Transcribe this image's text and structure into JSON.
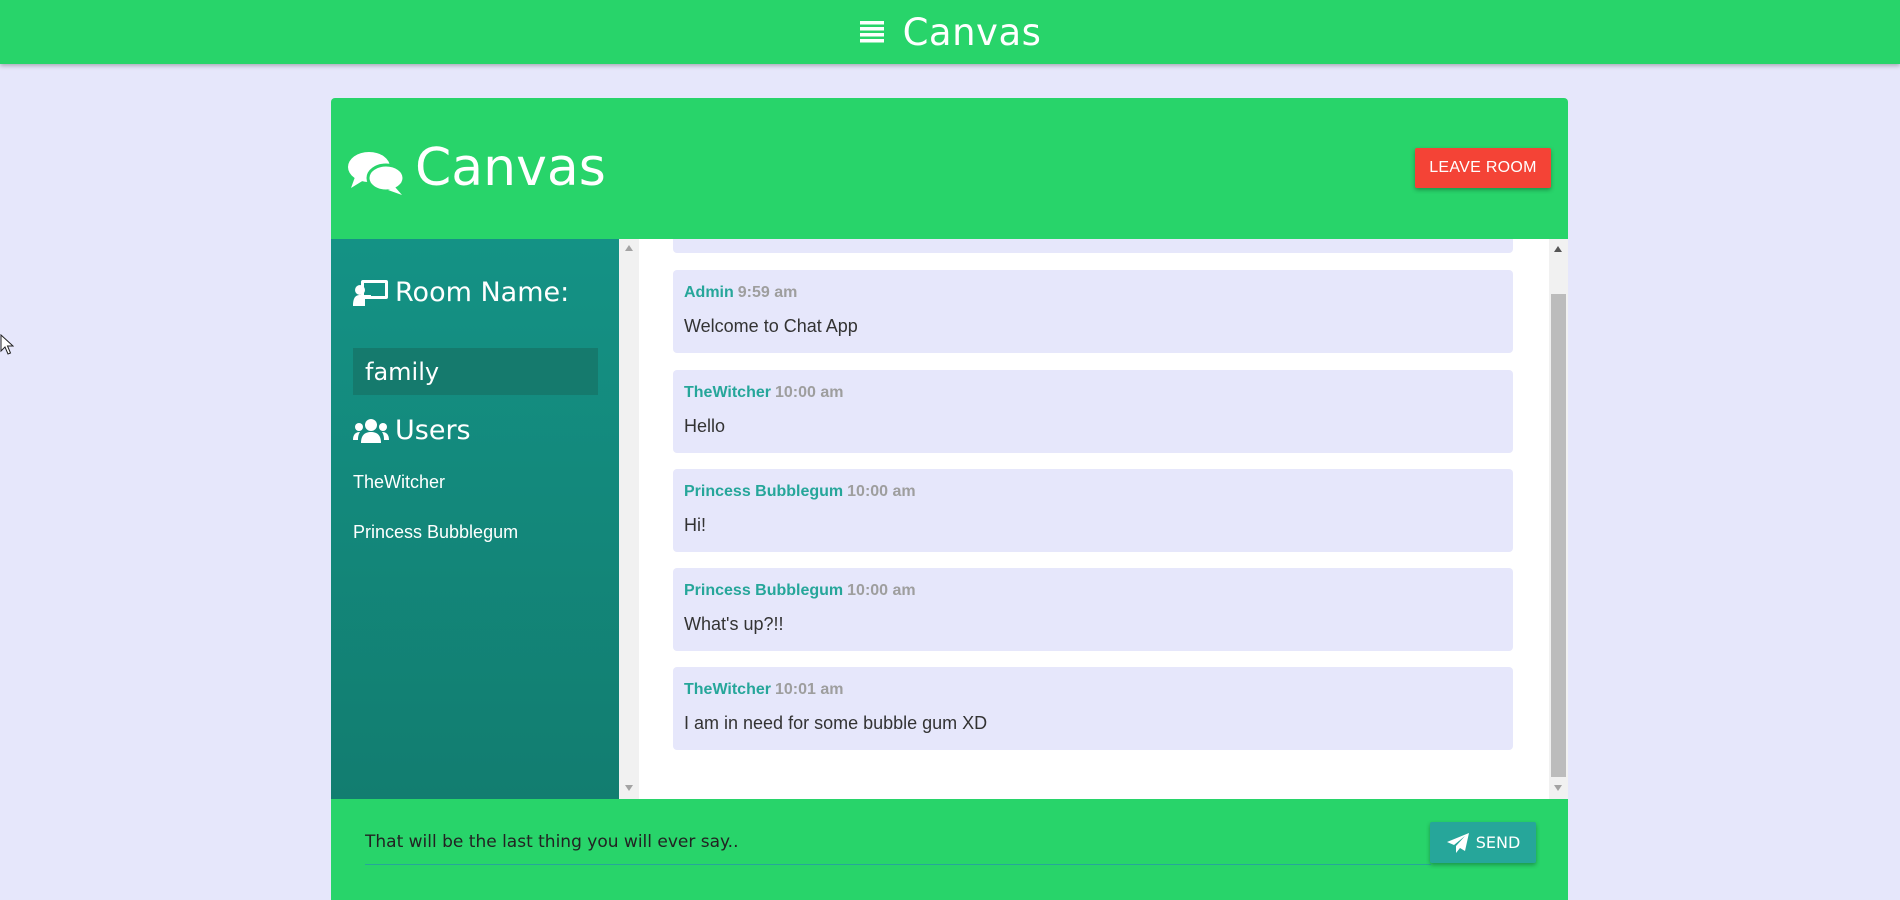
{
  "topbar": {
    "brand": "Canvas",
    "menu_icon": "menu-lines-icon"
  },
  "header": {
    "title": "Canvas",
    "chat_icon": "chat-bubbles-icon",
    "leave_label": "LEAVE ROOM"
  },
  "sidebar": {
    "room_heading": "Room Name:",
    "room_name": "family",
    "users_heading": "Users",
    "users": [
      "TheWitcher",
      "Princess Bubblegum"
    ]
  },
  "messages": [
    {
      "author": "Admin",
      "time": "9:59 am",
      "text": "Welcome to Chat App"
    },
    {
      "author": "TheWitcher",
      "time": "10:00 am",
      "text": "Hello"
    },
    {
      "author": "Princess Bubblegum",
      "time": "10:00 am",
      "text": "Hi!"
    },
    {
      "author": "Princess Bubblegum",
      "time": "10:00 am",
      "text": "What's up?!!"
    },
    {
      "author": "TheWitcher",
      "time": "10:01 am",
      "text": "I am in need for some bubble gum XD"
    }
  ],
  "composer": {
    "value": "That will be the last thing you will ever say..",
    "send_label": "SEND"
  },
  "colors": {
    "brand_green": "#28d46a",
    "sidebar_teal": "#149285",
    "accent_teal": "#26a69a",
    "leave_red": "#f44336",
    "page_bg": "#e6e7fb"
  }
}
